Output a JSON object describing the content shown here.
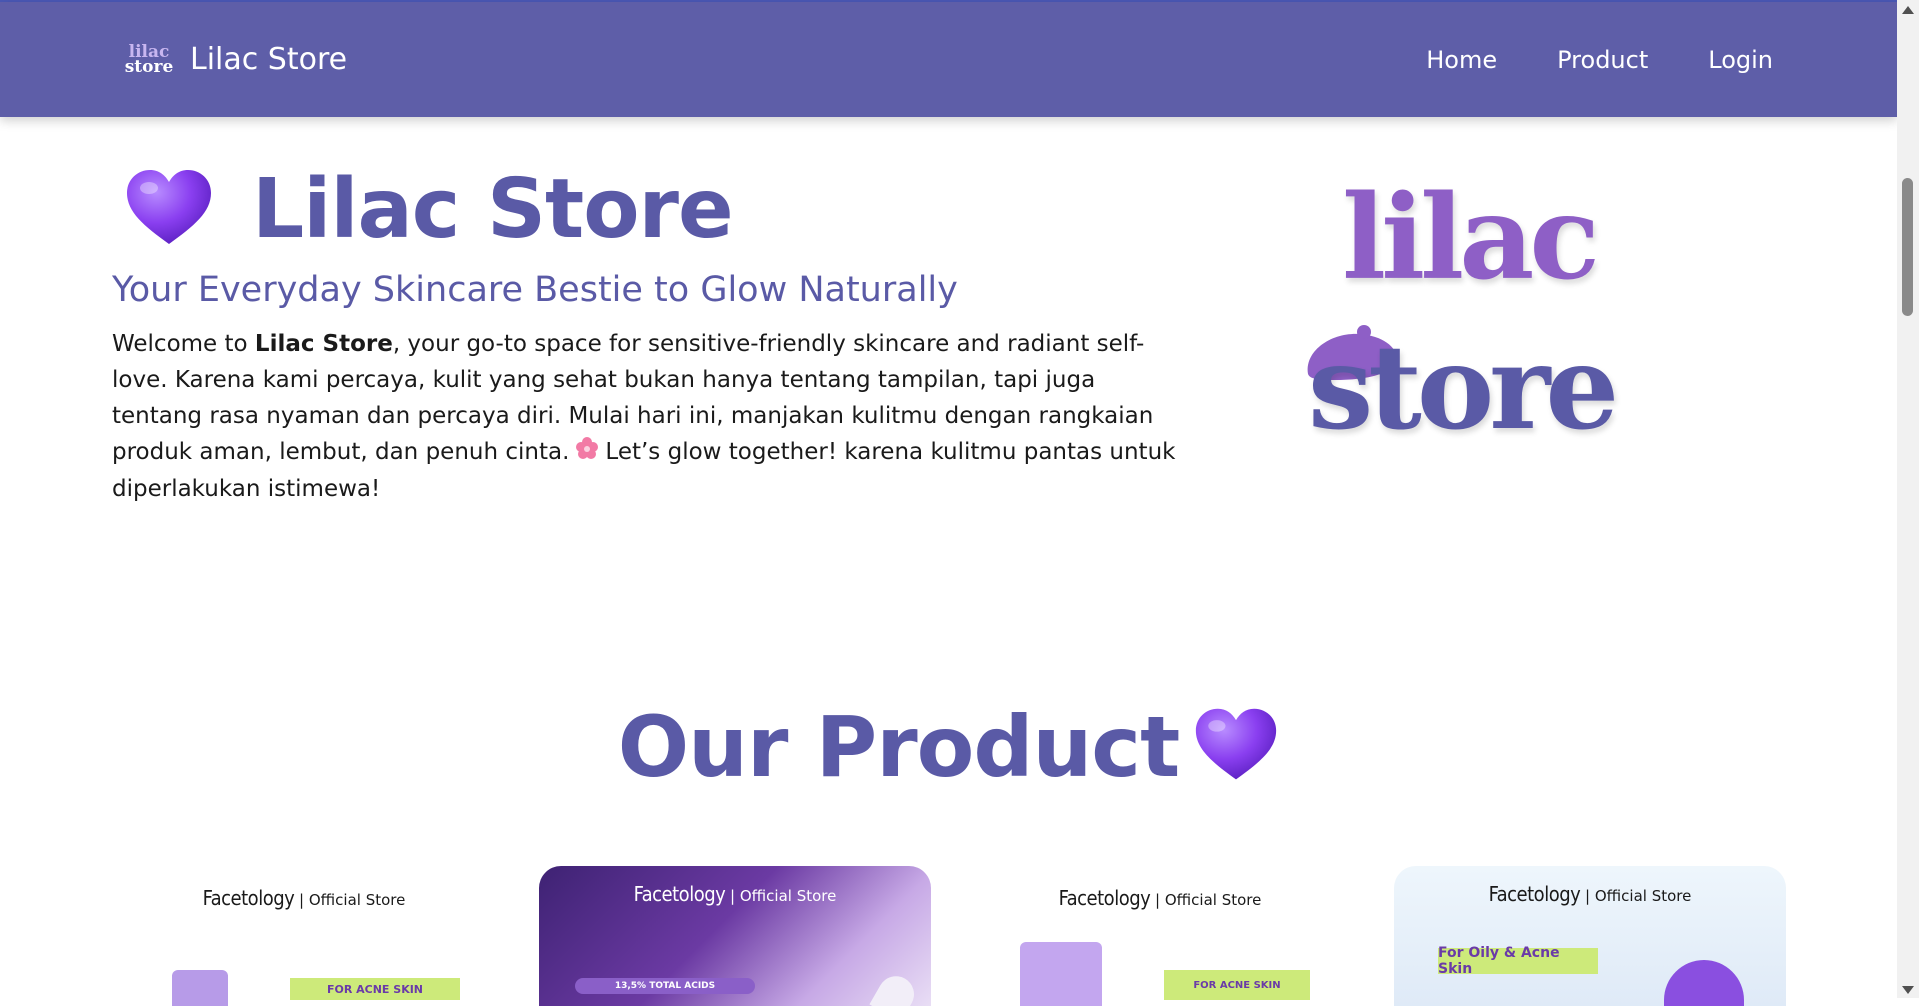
{
  "nav": {
    "logo_line1": "lilac",
    "logo_line2": "store",
    "brand": "Lilac Store",
    "links": [
      "Home",
      "Product",
      "Login"
    ]
  },
  "hero": {
    "title": "Lilac Store",
    "subtitle": "Your Everyday Skincare Bestie to Glow Naturally",
    "text_before": "Welcome to ",
    "text_bold": "Lilac Store",
    "text_after": ", your go-to space for sensitive-friendly skincare and radiant self-love. Karena kami percaya, kulit yang sehat bukan hanya tentang tampilan, tapi juga tentang rasa nyaman dan percaya diri. Mulai hari ini, manjakan kulitmu dengan rangkaian produk aman, lembut, dan penuh cinta.",
    "text_end": "Let’s glow together! karena kulitmu pantas untuk diperlakukan istimewa!",
    "logo_line1": "lilac",
    "logo_line2": "store"
  },
  "products": {
    "title": "Our Product",
    "cards": [
      {
        "brand": "Facetology",
        "store_label": "| Official Store",
        "tag": "FOR ACNE SKIN"
      },
      {
        "brand": "Facetology",
        "store_label": "| Official Store",
        "tag": "13,5% TOTAL ACIDS"
      },
      {
        "brand": "Facetology",
        "store_label": "| Official Store",
        "tag": "FOR ACNE SKIN"
      },
      {
        "brand": "Facetology",
        "store_label": "| Official Store",
        "tag": "For Oily & Acne Skin"
      }
    ]
  },
  "colors": {
    "navbar": "#5e5ea8",
    "accent": "#5a5aa6",
    "heart": "#8a3ff0",
    "logo_lilac": "#8e5fc6"
  },
  "icons": [
    "purple-heart-icon",
    "cherry-blossom-icon",
    "scroll-up-icon",
    "scroll-down-icon"
  ]
}
